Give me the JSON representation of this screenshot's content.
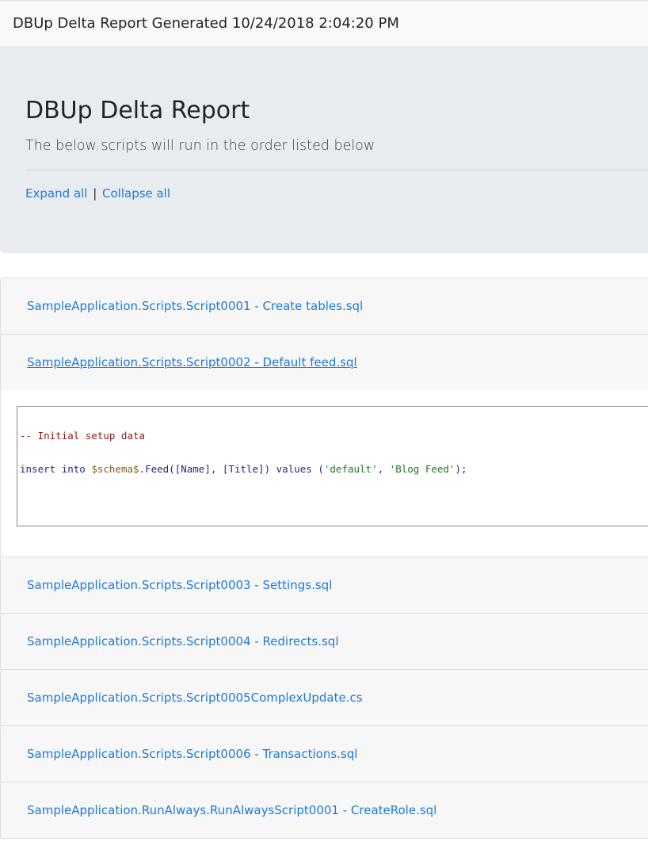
{
  "navbar": {
    "brand": "DBUp Delta Report Generated 10/24/2018 2:04:20 PM"
  },
  "jumbotron": {
    "title": "DBUp Delta Report",
    "lead": "The below scripts will run in the order listed below",
    "expand_all": "Expand all",
    "separator": "|",
    "collapse_all": "Collapse all"
  },
  "scripts": [
    {
      "name": "SampleApplication.Scripts.Script0001 - Create tables.sql",
      "expanded": false
    },
    {
      "name": "SampleApplication.Scripts.Script0002 - Default feed.sql",
      "expanded": true
    },
    {
      "name": "SampleApplication.Scripts.Script0003 - Settings.sql",
      "expanded": false
    },
    {
      "name": "SampleApplication.Scripts.Script0004 - Redirects.sql",
      "expanded": false
    },
    {
      "name": "SampleApplication.Scripts.Script0005ComplexUpdate.cs",
      "expanded": false
    },
    {
      "name": "SampleApplication.Scripts.Script0006 - Transactions.sql",
      "expanded": false
    },
    {
      "name": "SampleApplication.RunAlways.RunAlwaysScript0001 - CreateRole.sql",
      "expanded": false
    }
  ],
  "code": {
    "comment": "-- Initial setup data",
    "kw_insert": "insert",
    "kw_into": "into",
    "schema_var": "$schema$",
    "table_part": ".Feed([Name], [Title])",
    "kw_values": "values",
    "paren_open": "(",
    "str_default": "'default'",
    "comma": ", ",
    "str_blog": "'Blog Feed'",
    "end": ");"
  }
}
